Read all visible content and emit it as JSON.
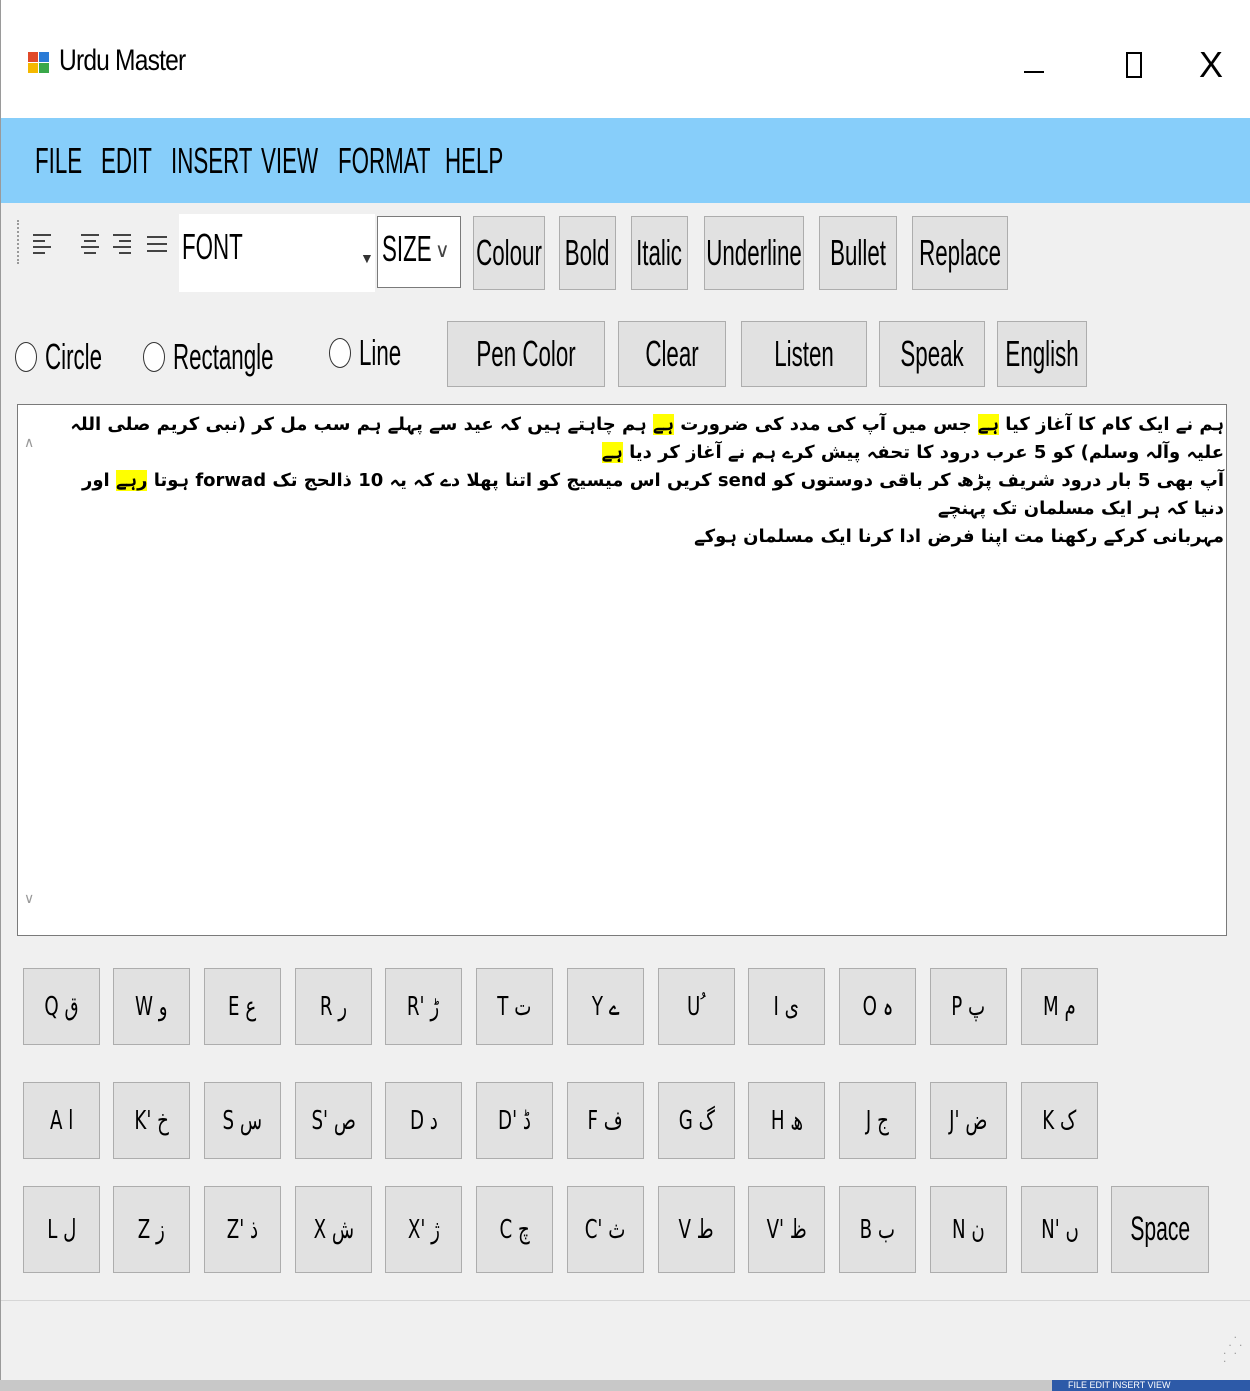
{
  "window": {
    "title": "Urdu Master",
    "icon": "app-window-icon",
    "controls": {
      "minimize_icon": "minimize-icon",
      "maximize_icon": "maximize-icon",
      "close_label": "X"
    }
  },
  "menu": {
    "items": [
      "FILE",
      "EDIT",
      "INSERT",
      "VIEW",
      "FORMAT",
      "HELP"
    ],
    "background": "#87cefa"
  },
  "toolbar": {
    "align_icons": [
      "align-left-icon",
      "align-center-icon",
      "align-right-icon",
      "align-justify-icon"
    ],
    "font_label": "FONT",
    "size_label": "SIZE",
    "buttons": [
      "Colour",
      "Bold",
      "Italic",
      "Underline",
      "Bullet",
      "Replace"
    ]
  },
  "drawing": {
    "shapes": [
      "Circle",
      "Rectangle",
      "Line"
    ],
    "buttons": [
      "Pen Color",
      "Clear",
      "Listen",
      "Speak",
      "English"
    ]
  },
  "editor": {
    "highlight_color": "#ffff00",
    "lines": [
      {
        "parts": [
          {
            "text": "ہم نے ایک کام کا آغاز کیا ",
            "hl": false
          },
          {
            "text": "ہے",
            "hl": true
          },
          {
            "text": " جس میں آپ کی مدد کی ضرورت ",
            "hl": false
          },
          {
            "text": "ہے",
            "hl": true
          },
          {
            "text": " ہم چاہتے ہیں کہ عید سے پہلے ہم سب مل کر (نبی کریم صلی اللہ علیہ وآلہ وسلم) کو 5 عرب درود کا تحفہ پیش کرے ہم نے آغاز کر دیا ",
            "hl": false
          },
          {
            "text": "ہے",
            "hl": true
          }
        ]
      },
      {
        "parts": [
          {
            "text": "آپ بھی 5 بار درود شریف پڑھ کر باقی دوستوں کو send کریں اس میسیج کو اتنا پھلا دے کہ یہ 10 ذالحج تک forwad ہوتا ",
            "hl": false
          },
          {
            "text": "رہے",
            "hl": true
          },
          {
            "text": " اور دنیا کہ ہر ایک مسلمان تک پہنچے",
            "hl": false
          }
        ]
      },
      {
        "parts": [
          {
            "text": "مہربانی کرکے رکھنا مت اپنا فرض ادا کرنا ایک مسلمان ہوکے",
            "hl": false
          }
        ]
      }
    ]
  },
  "keyboard": {
    "rows": [
      [
        "Q ق",
        "W و",
        "E ع",
        "R ر",
        "R' ڑ",
        "T ت",
        "Y ے",
        "U ُ",
        "I ی",
        "O ہ",
        "P پ",
        "M م"
      ],
      [
        "A ا",
        "K' خ",
        "S س",
        "S' ص",
        "D د",
        "D' ڈ",
        "F ف",
        "G گ",
        "H ھ",
        "J ج",
        "J' ض",
        "K ک"
      ],
      [
        "L ل",
        "Z ز",
        "Z' ذ",
        "X ش",
        "X' ژ",
        "C چ",
        "C' ث",
        "V ط",
        "V' ظ",
        "B ب",
        "N ن",
        "N' ں",
        "Space"
      ]
    ]
  },
  "taskbar": {
    "thumb_text": "FILE EDIT INSERT VIEW"
  }
}
